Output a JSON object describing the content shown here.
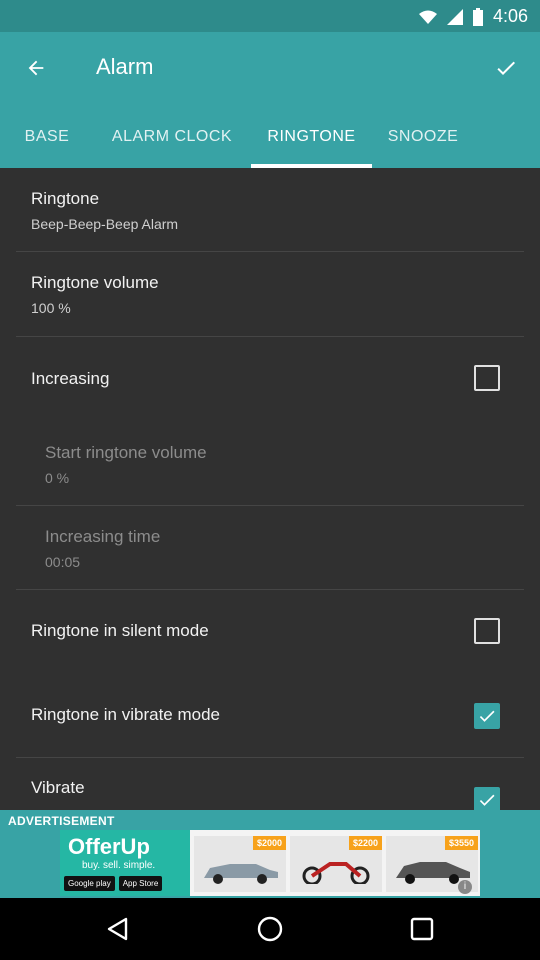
{
  "status_bar": {
    "time": "4:06"
  },
  "app_bar": {
    "title": "Alarm",
    "tabs": [
      {
        "label": "BASE"
      },
      {
        "label": "ALARM CLOCK"
      },
      {
        "label": "RINGTONE"
      },
      {
        "label": "SNOOZE"
      }
    ],
    "active_tab": "RINGTONE"
  },
  "settings": {
    "ringtone": {
      "title": "Ringtone",
      "value": "Beep-Beep-Beep Alarm"
    },
    "ringtone_volume": {
      "title": "Ringtone volume",
      "value": "100 %"
    },
    "increasing": {
      "title": "Increasing",
      "checked": false
    },
    "start_ringtone_volume": {
      "title": "Start ringtone volume",
      "value": "0 %"
    },
    "increasing_time": {
      "title": "Increasing time",
      "value": "00:05"
    },
    "silent_mode": {
      "title": "Ringtone in silent mode",
      "checked": false
    },
    "vibrate_mode": {
      "title": "Ringtone in vibrate mode",
      "checked": true
    },
    "vibrate": {
      "title": "Vibrate",
      "checked": true
    }
  },
  "ad": {
    "label": "ADVERTISEMENT",
    "brand": "OfferUp",
    "tagline": "buy. sell. simple.",
    "stores": [
      "Google play",
      "App Store"
    ],
    "prices": [
      "$2000",
      "$2200",
      "$3550"
    ]
  },
  "colors": {
    "primary": "#38a3a5",
    "primary_dark": "#2e8b8b",
    "background": "#303030"
  },
  "icons": {
    "back": "arrow-back-icon",
    "confirm": "check-icon",
    "nav_back": "triangle-back-icon",
    "nav_home": "circle-home-icon",
    "nav_recents": "square-recents-icon"
  }
}
